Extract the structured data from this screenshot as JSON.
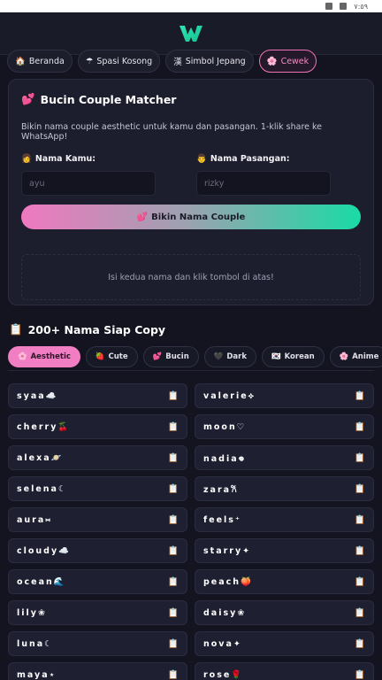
{
  "status": {
    "time": "٧:٥٩"
  },
  "tabs": [
    {
      "icon": "🏠",
      "label": "Beranda",
      "active": false
    },
    {
      "icon": "☂",
      "label": "Spasi Kosong",
      "active": false
    },
    {
      "icon": "漢",
      "label": "Simbol Jepang",
      "active": false
    },
    {
      "icon": "🌸",
      "label": "Cewek",
      "active": true
    }
  ],
  "matcher": {
    "icon": "💕",
    "title": "Bucin Couple Matcher",
    "description": "Bikin nama couple aesthetic untuk kamu dan pasangan. 1-klik share ke WhatsApp!",
    "field1": {
      "icon": "👩",
      "label": "Nama Kamu:",
      "placeholder": "ayu"
    },
    "field2": {
      "icon": "👨",
      "label": "Nama Pasangan:",
      "placeholder": "rizky"
    },
    "button": {
      "icon": "💕",
      "label": "Bikin Nama Couple"
    },
    "result_text": "Isi kedua nama dan klik tombol di atas!"
  },
  "names_section": {
    "icon": "📋",
    "title": "200+ Nama Siap Copy",
    "filters": [
      {
        "icon": "🌸",
        "label": "Aesthetic",
        "active": true
      },
      {
        "icon": "🍓",
        "label": "Cute",
        "active": false
      },
      {
        "icon": "💕",
        "label": "Bucin",
        "active": false
      },
      {
        "icon": "🖤",
        "label": "Dark",
        "active": false
      },
      {
        "icon": "🇰🇷",
        "label": "Korean",
        "active": false
      },
      {
        "icon": "🌸",
        "label": "Anime",
        "active": false
      }
    ],
    "copy_icon": "📋",
    "names": [
      "syaa☁️",
      "valerie⟡",
      "cherry🍒",
      "moon♡",
      "alexa🪐",
      "nadia𖦹",
      "selena☾",
      "zara𐙚",
      "aura⑅",
      "feels⁺",
      "cloudy☁️",
      "starry✦",
      "ocean🌊",
      "peach🍑",
      "lily❀",
      "daisy❀",
      "luna☾",
      "nova✦",
      "maya⋆",
      "rose🌹"
    ]
  }
}
